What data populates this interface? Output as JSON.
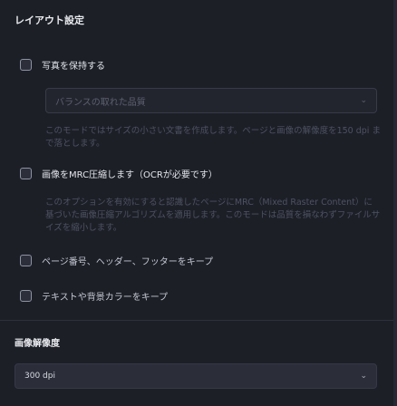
{
  "layout_section": {
    "title": "レイアウト設定",
    "options": {
      "preserve_photos": {
        "label": "写真を保持する",
        "checked": false
      },
      "mrc_compress": {
        "label": "画像をMRC圧縮します（OCRが必要です）",
        "checked": false
      },
      "keep_page_numbers": {
        "label": "ページ番号、ヘッダー、フッターをキープ",
        "checked": false
      },
      "keep_text_bg_color": {
        "label": "テキストや背景カラーをキープ",
        "checked": false
      }
    },
    "photo_quality": {
      "selected": "バランスの取れた品質",
      "description": "このモードではサイズの小さい文書を作成します。ページと画像の解像度を150 dpi まで落とします。"
    },
    "mrc_description": "このオプションを有効にすると認識したページにMRC（Mixed Raster Content）に基づいた画像圧縮アルゴリズムを適用します。このモードは品質を損なわずファイルサイズを縮小します。"
  },
  "resolution_section": {
    "title": "画像解像度",
    "selected": "300 dpi"
  },
  "colors": {
    "background": "#1d1f27",
    "checkbox_border": "#8d92a2",
    "dim_text": "#4d5262"
  },
  "icons": {
    "dropdown": "chevron-down-icon"
  }
}
